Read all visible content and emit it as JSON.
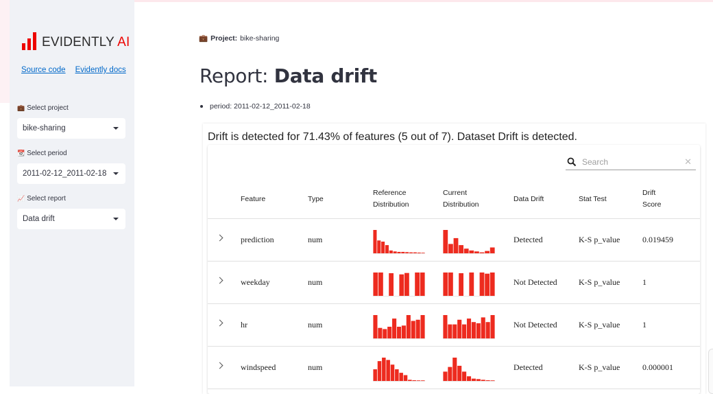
{
  "sidebar": {
    "logo": {
      "brand": "EVIDENTLY",
      "suffix": "AI",
      "color": "#ed0400"
    },
    "links": [
      "Source code",
      "Evidently docs"
    ],
    "project": {
      "label": "Select project",
      "icon": "briefcase-icon",
      "value": "bike-sharing"
    },
    "period": {
      "label": "Select period",
      "icon": "calendar-icon",
      "value": "2011-02-12_2011-02-18"
    },
    "report": {
      "label": "Select report",
      "icon": "chart-icon",
      "value": "Data drift"
    }
  },
  "main": {
    "project_prefix": "Project:",
    "project_name": "bike-sharing",
    "title_prefix": "Report:",
    "title_main": "Data drift",
    "period_text": "period: 2011-02-12_2011-02-18",
    "headline": "Drift is detected for 71.43% of features (5 out of 7). Dataset Drift is detected."
  },
  "table": {
    "search_placeholder": "Search",
    "headers": {
      "feature": "Feature",
      "type": "Type",
      "ref_dist_1": "Reference",
      "ref_dist_2": "Distribution",
      "cur_dist_1": "Current",
      "cur_dist_2": "Distribution",
      "drift": "Data Drift",
      "stat": "Stat Test",
      "score_1": "Drift",
      "score_2": "Score"
    },
    "bar_color": "#ed2b1f",
    "rows": [
      {
        "feature": "prediction",
        "type": "num",
        "drift": "Detected",
        "stat": "K-S p_value",
        "score": "0.019459",
        "ref": [
          1.0,
          0.55,
          0.5,
          0.35,
          0.12,
          0.08,
          0.06,
          0.06,
          0.05,
          0.04,
          0.04,
          0.03,
          0.02
        ],
        "cur": [
          1.0,
          0.4,
          0.65,
          0.35,
          0.2,
          0.12,
          0.08,
          0.04,
          0.1,
          0.25
        ]
      },
      {
        "feature": "weekday",
        "type": "num",
        "drift": "Not Detected",
        "stat": "K-S p_value",
        "score": "1",
        "ref": [
          1,
          1,
          0,
          0.97,
          0,
          0.92,
          0.98,
          0,
          1,
          1
        ],
        "cur": [
          1,
          1,
          0,
          0.97,
          0,
          1,
          0,
          1,
          0.95,
          1
        ]
      },
      {
        "feature": "hr",
        "type": "num",
        "drift": "Not Detected",
        "stat": "K-S p_value",
        "score": "1",
        "ref": [
          1.0,
          0.45,
          0.4,
          0.5,
          0.85,
          0.5,
          0.55,
          1.0,
          0.75,
          0.8,
          1.0
        ],
        "cur": [
          1.0,
          0.6,
          0.6,
          0.8,
          0.6,
          0.85,
          0.7,
          0.65,
          0.9,
          0.7,
          1.0
        ]
      },
      {
        "feature": "windspeed",
        "type": "num",
        "drift": "Detected",
        "stat": "K-S p_value",
        "score": "0.000001",
        "ref": [
          0.5,
          0.85,
          1.0,
          0.9,
          0.7,
          0.5,
          0.35,
          0.25,
          0.05,
          0.03,
          0.02,
          0.02
        ],
        "cur": [
          0.4,
          0.6,
          1.0,
          0.65,
          0.4,
          0.2,
          0.1,
          0.08,
          0.05,
          0.03,
          0.02
        ]
      }
    ]
  }
}
